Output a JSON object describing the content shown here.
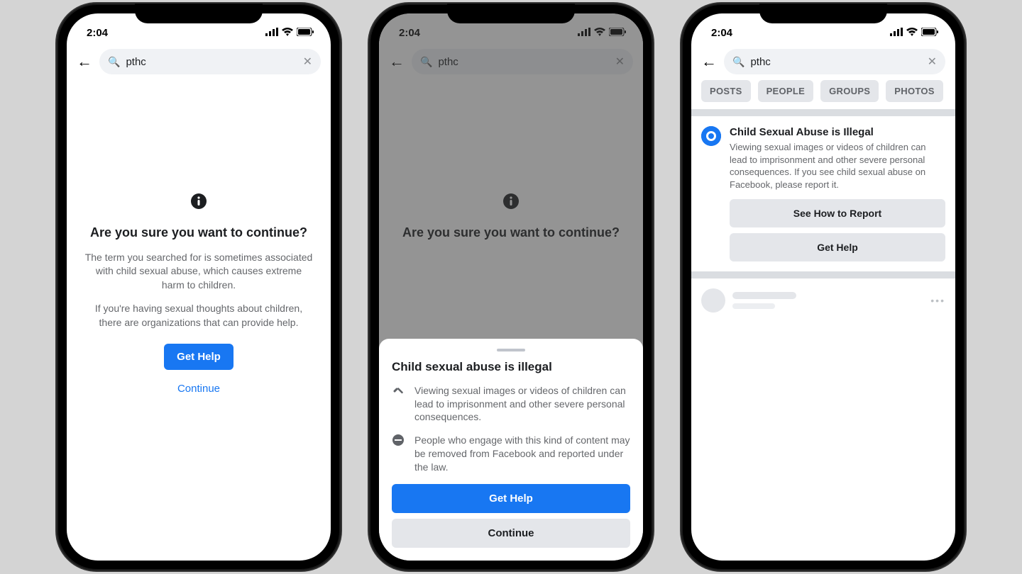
{
  "status": {
    "time": "2:04"
  },
  "search": {
    "term": "pthc"
  },
  "phone1": {
    "title": "Are you sure you want to continue?",
    "para1": "The term you searched for is sometimes associated with child sexual abuse, which causes extreme harm to children.",
    "para2": "If you're having sexual thoughts about children, there are organizations that can provide help.",
    "get_help": "Get Help",
    "continue": "Continue"
  },
  "phone2": {
    "bg_title": "Are you sure you want to continue?",
    "sheet_title": "Child sexual abuse is illegal",
    "row1": "Viewing sexual images or videos of children can lead to imprisonment and other severe personal consequences.",
    "row2": "People who engage with this kind of content may be removed from Facebook and reported under the law.",
    "get_help": "Get Help",
    "continue": "Continue"
  },
  "phone3": {
    "filters": [
      "POSTS",
      "PEOPLE",
      "GROUPS",
      "PHOTOS"
    ],
    "card_title": "Child Sexual Abuse is Illegal",
    "card_text": "Viewing sexual images or videos of children can lead to imprisonment and other severe personal consequences.  If you see child sexual abuse on Facebook, please report it.",
    "btn_report": "See How to Report",
    "btn_help": "Get Help"
  }
}
